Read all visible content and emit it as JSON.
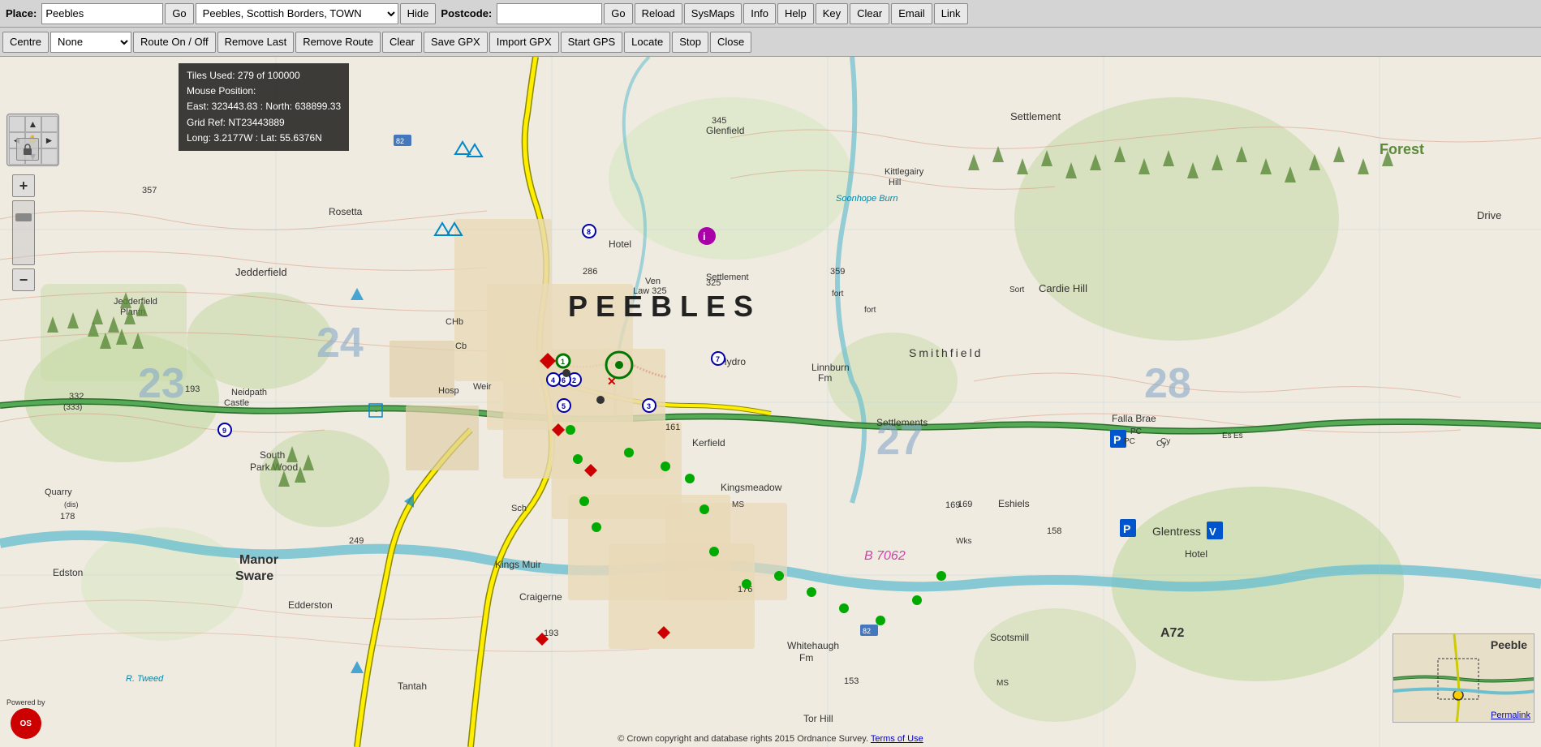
{
  "toolbar1": {
    "place_label": "Place:",
    "place_value": "Peebles",
    "go1_label": "Go",
    "dropdown_value": "Peebles, Scottish Borders, TOWN",
    "dropdown_options": [
      "Peebles, Scottish Borders, TOWN"
    ],
    "hide_label": "Hide",
    "postcode_label": "Postcode:",
    "postcode_value": "",
    "go2_label": "Go",
    "reload_label": "Reload",
    "sysmaps_label": "SysMaps",
    "info_label": "Info",
    "help_label": "Help",
    "key_label": "Key",
    "clear_label": "Clear",
    "email_label": "Email",
    "link_label": "Link"
  },
  "toolbar2": {
    "centre_label": "Centre",
    "centre_select_value": "None",
    "centre_options": [
      "None"
    ],
    "route_on_off_label": "Route On / Off",
    "remove_last_label": "Remove Last",
    "remove_route_label": "Remove Route",
    "clear_label": "Clear",
    "save_gpx_label": "Save GPX",
    "import_gpx_label": "Import GPX",
    "start_gps_label": "Start GPS",
    "locate_label": "Locate",
    "stop_label": "Stop",
    "close_label": "Close"
  },
  "info_overlay": {
    "tiles_used": "Tiles Used: 279 of 100000",
    "mouse_position": "Mouse Position:",
    "east": "East: 323443.83 : North: 638899.33",
    "grid_ref": "Grid Ref: NT23443889",
    "long_lat": "Long: 3.2177W : Lat: 55.6376N"
  },
  "compass": {
    "up": "▲",
    "down": "▼",
    "left": "◄",
    "right": "►",
    "center_icon": "✋"
  },
  "zoom": {
    "plus": "+",
    "minus": "−"
  },
  "minimap": {
    "label": "Peeble",
    "permalink": "Permalink"
  },
  "footer": {
    "copyright": "© Crown copyright and database rights 2015 Ordnance Survey.",
    "terms_text": "Terms of Use"
  },
  "os_logo": {
    "powered_by": "Powered by",
    "initials": "OS"
  },
  "map": {
    "place_name": "PEEBLES",
    "locations": [
      "Glenfield",
      "Kittlegairy Hill",
      "Settlement",
      "Smithfield",
      "Cardie Hill",
      "Jedderfield",
      "Jedderfield Plantn",
      "South Park Wood",
      "Manor Sware",
      "Kerfield",
      "Kingsmeadow",
      "Eshiels",
      "Glentress",
      "Scotsmill",
      "Whitehaugh Fm",
      "Craigerne",
      "Kings Muir",
      "Edderston",
      "Edston",
      "Rosetta",
      "Linnburn Fm",
      "Settlements",
      "Falla Brae",
      "Hotel",
      "Ven Law 325",
      "Hydro",
      "Weir",
      "Hosp",
      "Tantah",
      "Tor Hill"
    ],
    "grid_numbers": [
      "24",
      "23",
      "27",
      "28"
    ],
    "road_labels": [
      "B 7062"
    ],
    "height_labels": [
      "345",
      "357",
      "193",
      "178",
      "249",
      "286",
      "325",
      "359",
      "169",
      "161",
      "158",
      "176",
      "153",
      "193"
    ]
  }
}
